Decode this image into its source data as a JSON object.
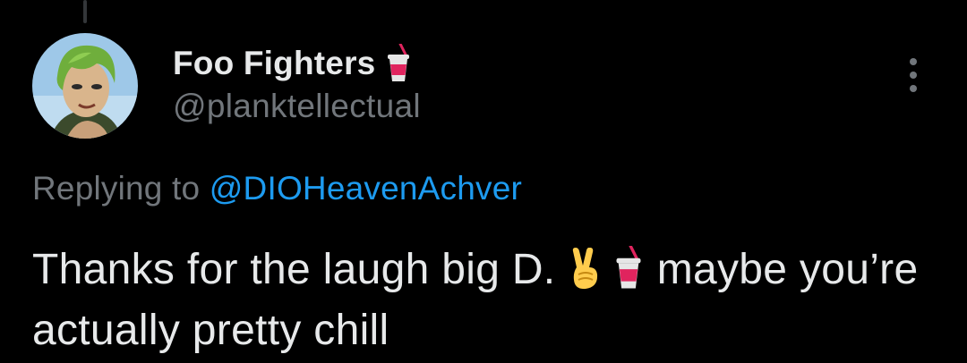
{
  "tweet": {
    "display_name": "Foo Fighters",
    "handle": "@planktellectual",
    "reply_prefix": "Replying to ",
    "reply_mention": "@DIOHeavenAchver",
    "text_part1": "Thanks for the laugh big D. ",
    "text_part2": " maybe you’re actually pretty chill",
    "name_emoji": "cup-with-straw-emoji",
    "text_emojis": [
      "victory-hand-emoji",
      "cup-with-straw-emoji"
    ]
  },
  "icons": {
    "more": "more-vertical-icon",
    "avatar": "avatar"
  },
  "colors": {
    "background": "#000000",
    "primary_text": "#e7e9ea",
    "secondary_text": "#71767b",
    "link": "#1d9bf0"
  }
}
